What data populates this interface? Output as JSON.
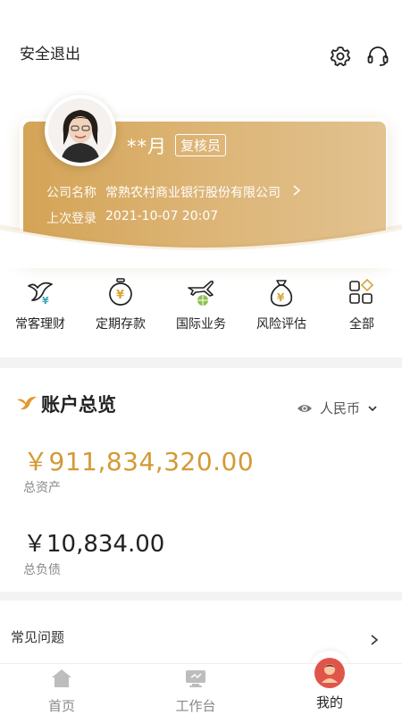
{
  "header": {
    "logout_label": "安全退出",
    "settings_icon": "gear-icon",
    "service_icon": "headset-icon"
  },
  "profile": {
    "name": "**月",
    "role": "复核员",
    "company_label": "公司名称",
    "company_value": "常熟农村商业银行股份有限公司",
    "last_login_label": "上次登录",
    "last_login_value": "2021-10-07 20:07"
  },
  "menu": {
    "items": [
      {
        "label": "常客理财",
        "icon": "bird-yen-icon"
      },
      {
        "label": "定期存款",
        "icon": "stopwatch-yen-icon"
      },
      {
        "label": "国际业务",
        "icon": "plane-globe-icon"
      },
      {
        "label": "风险评估",
        "icon": "money-bag-icon"
      },
      {
        "label": "全部",
        "icon": "grid-icon"
      }
    ]
  },
  "overview": {
    "title": "账户总览",
    "currency": "人民币",
    "total_assets": "￥911,834,320.00",
    "total_assets_label": "总资产",
    "total_debt": "￥10,834.00",
    "total_debt_label": "总负债"
  },
  "faq": {
    "label": "常见问题"
  },
  "tabbar": {
    "items": [
      {
        "label": "首页"
      },
      {
        "label": "工作台"
      },
      {
        "label": "我的"
      }
    ],
    "active_index": 2
  },
  "colors": {
    "gold": "#d49a35",
    "card_start": "#d4a456",
    "card_end": "#e2c290",
    "accent_red": "#e0554a"
  }
}
